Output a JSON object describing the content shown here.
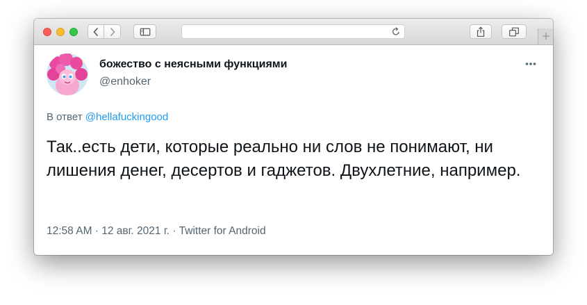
{
  "browser": {
    "address_value": "",
    "icons": {
      "close": "close-traffic-light-icon",
      "minimize": "minimize-traffic-light-icon",
      "zoom": "zoom-traffic-light-icon",
      "back": "chevron-left-icon",
      "forward": "chevron-right-icon",
      "sidebar": "sidebar-icon",
      "reload": "reload-icon",
      "share": "share-icon",
      "tabs": "tabs-overview-icon",
      "new_tab": "plus-icon"
    },
    "colors": {
      "close": "#fc5f57",
      "minimize": "#fdbc2f",
      "zoom": "#34c749"
    }
  },
  "tweet": {
    "display_name": "божество с неясными функциями",
    "handle": "@enhoker",
    "replying_prefix": "В ответ",
    "replying_to": "@hellafuckingood",
    "text": "Так..есть дети, которые реально ни слов не понимают, ни лишения денег, десертов и гаджетов. Двухлетние, например.",
    "meta": "12:58 AM · 12 авг. 2021 г. · Twitter for Android",
    "more_icon": "more-options-icon",
    "colors": {
      "text": "#0f1419",
      "secondary": "#536471",
      "link": "#1d9bf0"
    }
  }
}
